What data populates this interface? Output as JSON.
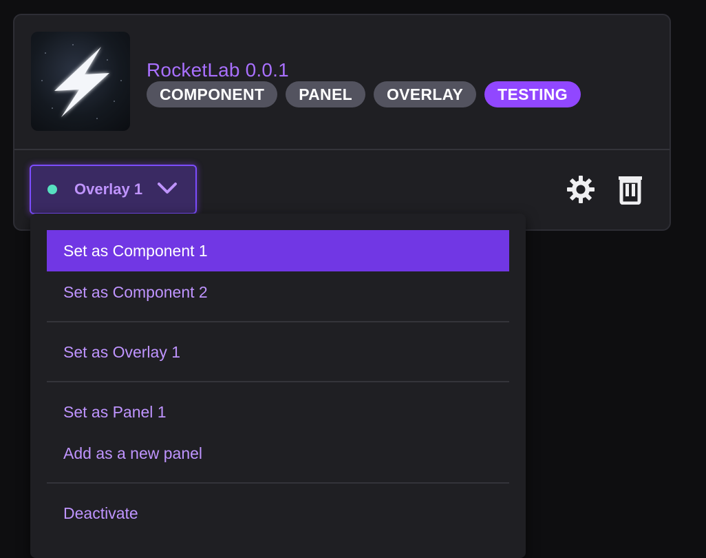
{
  "extension": {
    "name_version": "RocketLab 0.0.1",
    "thumbnail_icon": "lightning-bolt-icon",
    "tags": [
      {
        "label": "COMPONENT",
        "color": "#53535f"
      },
      {
        "label": "PANEL",
        "color": "#53535f"
      },
      {
        "label": "OVERLAY",
        "color": "#53535f"
      },
      {
        "label": "TESTING",
        "color": "#9147ff"
      }
    ]
  },
  "slot_select": {
    "label": "Overlay 1",
    "status_color": "#57e0c0",
    "icon": "chevron-down-icon"
  },
  "actions": {
    "settings_icon": "gear-icon",
    "delete_icon": "trash-icon"
  },
  "menu": {
    "groups": [
      [
        "Set as Component 1",
        "Set as Component 2"
      ],
      [
        "Set as Overlay 1"
      ],
      [
        "Set as Panel 1",
        "Add as a new panel"
      ],
      [
        "Deactivate"
      ]
    ],
    "active_item": "Set as Component 1"
  },
  "colors": {
    "accent": "#9147ff",
    "accent_text": "#bf94ff",
    "menu_active": "#7137e4",
    "background": "#0e0e10",
    "card": "#1f1f23"
  }
}
